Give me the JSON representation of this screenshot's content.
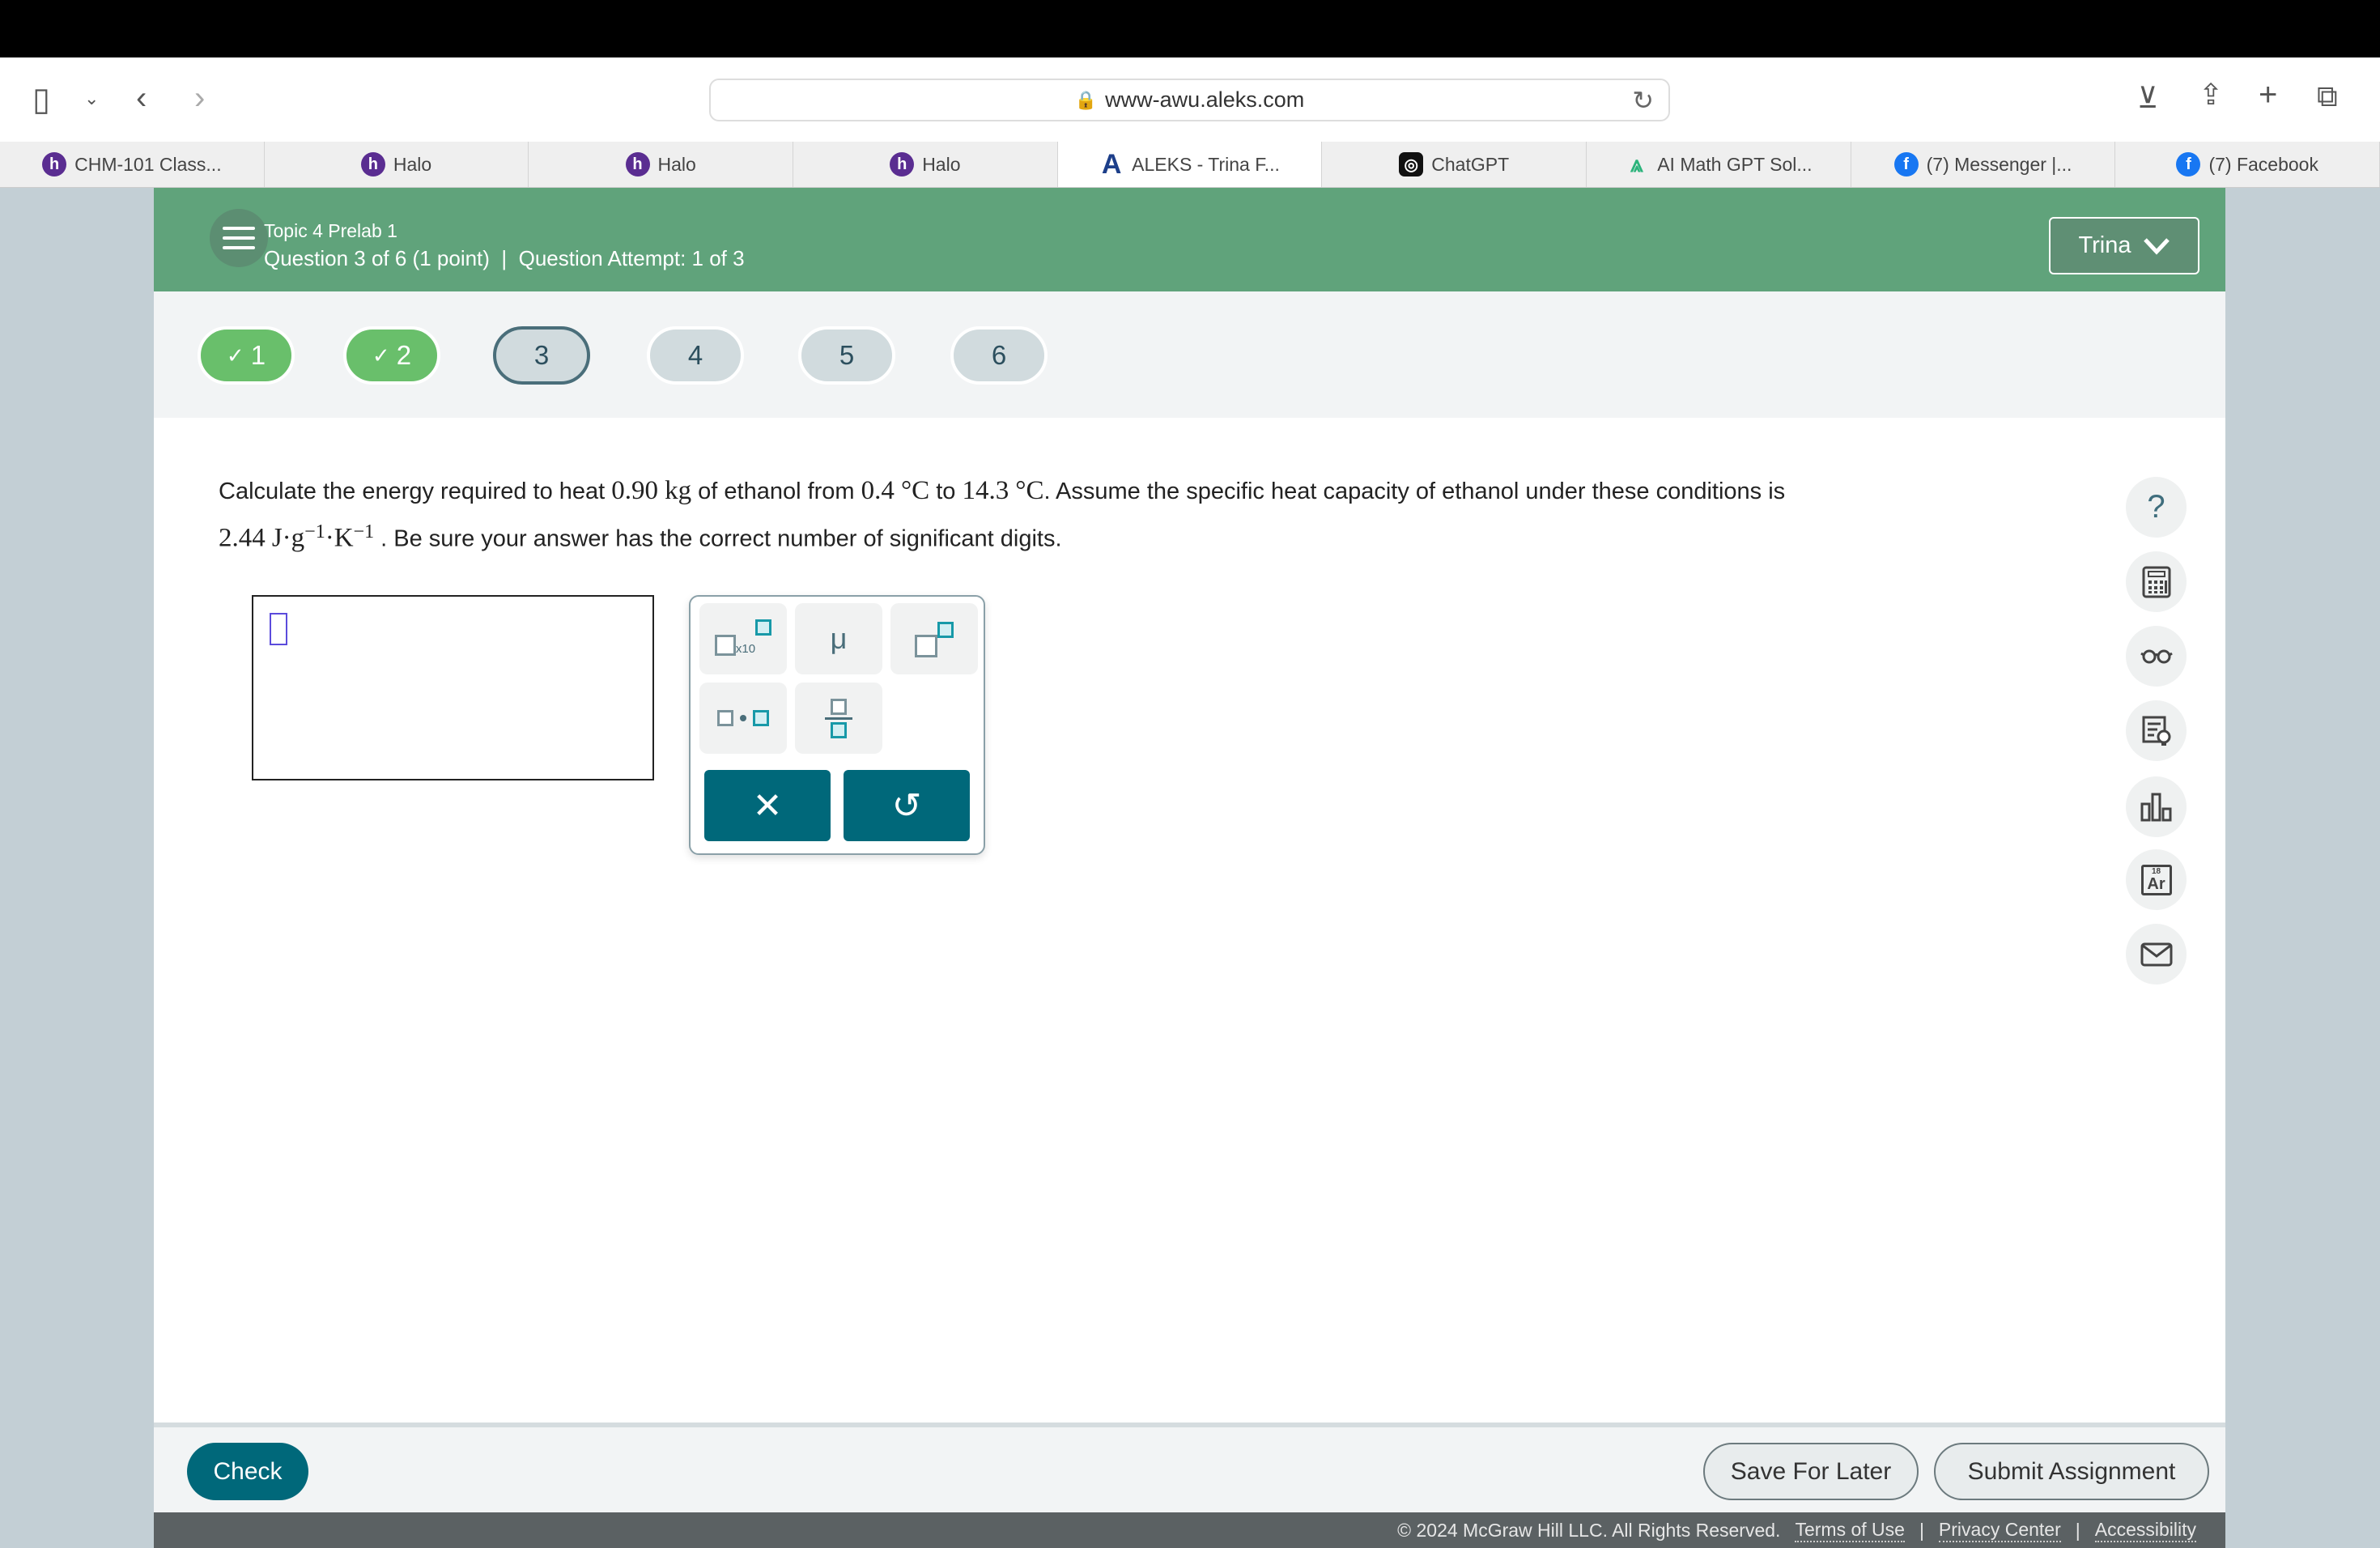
{
  "browser": {
    "url": "www-awu.aleks.com",
    "tabs": [
      {
        "label": "CHM-101 Class...",
        "icon": "halo-icon",
        "active": false
      },
      {
        "label": "Halo",
        "icon": "halo-icon",
        "active": false
      },
      {
        "label": "Halo",
        "icon": "halo-icon",
        "active": false
      },
      {
        "label": "Halo",
        "icon": "halo-icon",
        "active": false
      },
      {
        "label": "ALEKS - Trina F...",
        "icon": "aleks-icon",
        "active": true
      },
      {
        "label": "ChatGPT",
        "icon": "chatgpt-icon",
        "active": false
      },
      {
        "label": "AI Math GPT Sol...",
        "icon": "compass-icon",
        "active": false
      },
      {
        "label": "(7) Messenger |...",
        "icon": "facebook-icon",
        "active": false
      },
      {
        "label": "(7) Facebook",
        "icon": "facebook-icon",
        "active": false
      }
    ]
  },
  "header": {
    "topic": "Topic 4 Prelab 1",
    "question_info": "Question 3 of 6 (1 point)",
    "separator": "|",
    "attempt": "Question Attempt: 1 of 3",
    "user": "Trina",
    "color": "#60a37b"
  },
  "question_nav": [
    {
      "label": "1",
      "status": "correct"
    },
    {
      "label": "2",
      "status": "correct"
    },
    {
      "label": "3",
      "status": "current"
    },
    {
      "label": "4",
      "status": "unanswered"
    },
    {
      "label": "5",
      "status": "unanswered"
    },
    {
      "label": "6",
      "status": "unanswered"
    }
  ],
  "question": {
    "t1": "Calculate the energy required to heat ",
    "mass": "0.90",
    "mass_unit": "kg",
    "t2": " of ethanol from ",
    "t_start": "0.4",
    "deg": "°C",
    "t3": " to ",
    "t_end": "14.3",
    "t4": ". Assume the specific heat capacity of ethanol under these conditions is",
    "cp": "2.44",
    "cp_unit_a": "J·g",
    "exp": "−1",
    "cp_unit_b": "·K",
    "t5": ". Be sure your answer has the correct number of significant digits."
  },
  "answer": {
    "value": ""
  },
  "palette": {
    "sci_label": "x10",
    "mu": "μ"
  },
  "tools": [
    "help-icon",
    "calculator-icon",
    "glasses-icon",
    "hint-icon",
    "chart-icon",
    "periodic-table-icon",
    "mail-icon"
  ],
  "tool_labels": {
    "help": "?",
    "element_num": "18",
    "element_sym": "Ar"
  },
  "bottom": {
    "check": "Check",
    "save": "Save For Later",
    "submit": "Submit Assignment"
  },
  "footer": {
    "copyright": "© 2024 McGraw Hill LLC. All Rights Reserved.",
    "terms": "Terms of Use",
    "privacy": "Privacy Center",
    "accessibility": "Accessibility",
    "sep": "|"
  }
}
